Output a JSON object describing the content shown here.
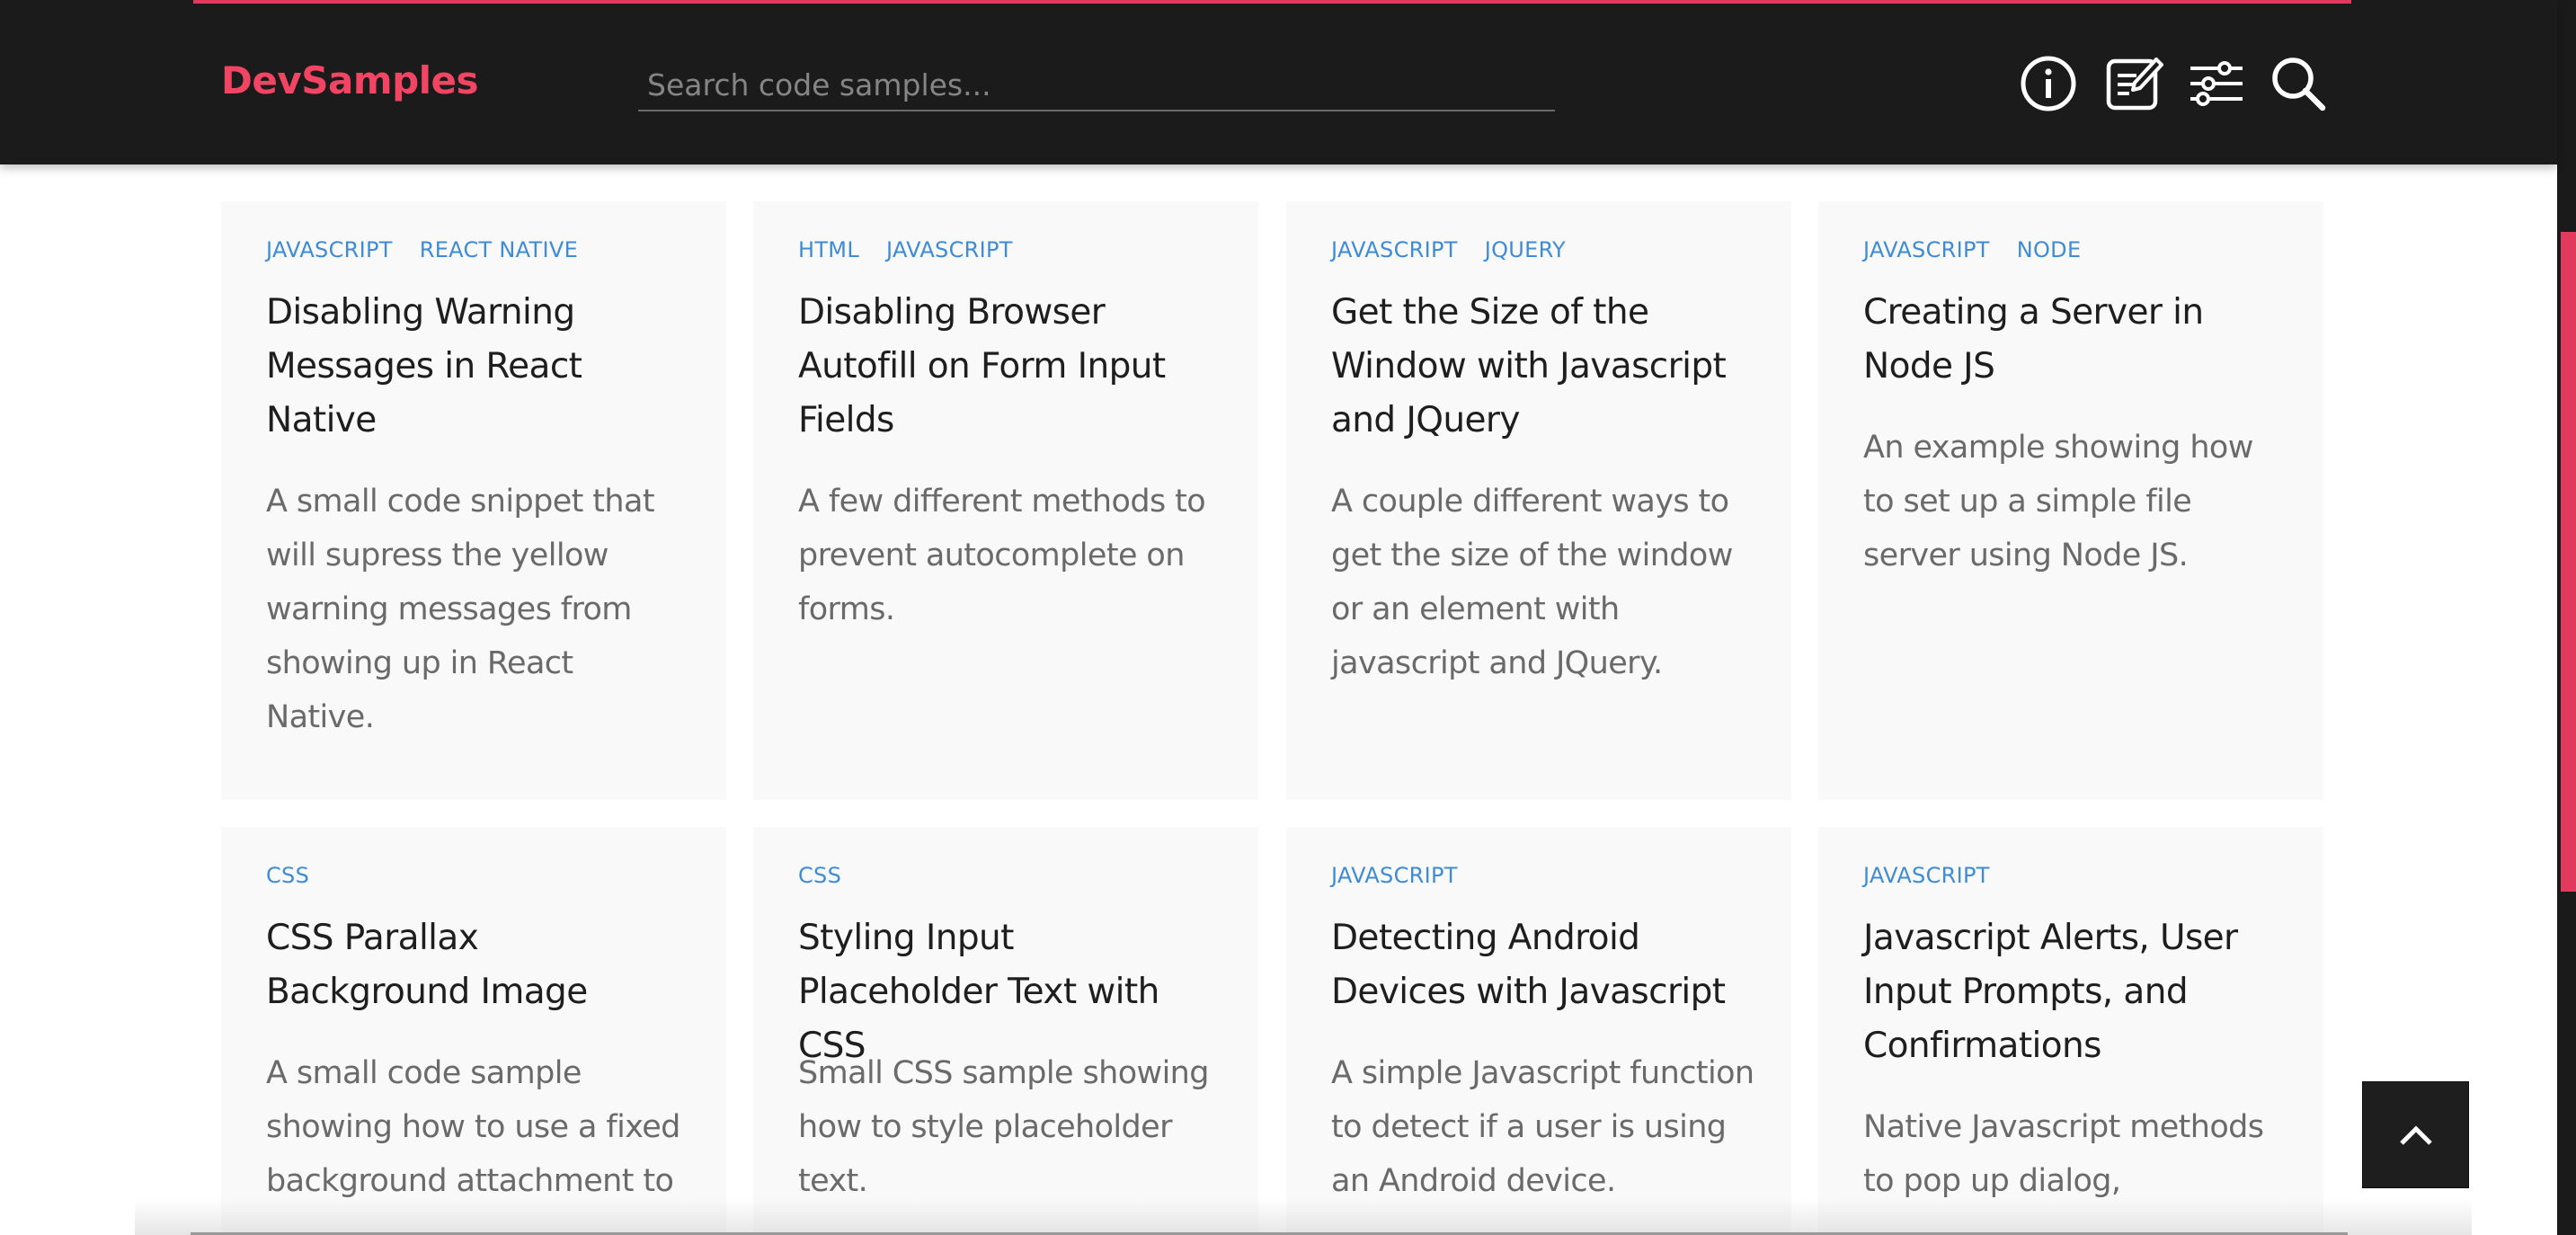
{
  "app": {
    "brand": "DevSamples",
    "accent_color": "#e23a5c"
  },
  "header": {
    "search_placeholder": "Search code samples...",
    "icons": [
      "info-icon",
      "notes-icon",
      "filter-sliders-icon",
      "search-icon"
    ]
  },
  "cards": [
    {
      "tags": [
        "JAVASCRIPT",
        "REACT NATIVE"
      ],
      "title": "Disabling Warning Messages in React Native",
      "description": "A small code snippet that will supress the yellow warning messages from showing up in React Native."
    },
    {
      "tags": [
        "HTML",
        "JAVASCRIPT"
      ],
      "title": "Disabling Browser Autofill on Form Input Fields",
      "description": "A few different methods to prevent autocomplete on forms."
    },
    {
      "tags": [
        "JAVASCRIPT",
        "JQUERY"
      ],
      "title": "Get the Size of the Window with Javascript and JQuery",
      "description": "A couple different ways to get the size of the window or an element with javascript and JQuery."
    },
    {
      "tags": [
        "JAVASCRIPT",
        "NODE"
      ],
      "title": "Creating a Server in Node JS",
      "description": "An example showing how to set up a simple file server using Node JS."
    },
    {
      "tags": [
        "CSS"
      ],
      "title": "CSS Parallax Background Image",
      "description": "A small code sample showing how to use a fixed background attachment to"
    },
    {
      "tags": [
        "CSS"
      ],
      "title": "Styling Input Placeholder Text with CSS",
      "description": "Small CSS sample showing how to style placeholder text."
    },
    {
      "tags": [
        "JAVASCRIPT"
      ],
      "title": "Detecting Android Devices with Javascript",
      "description": "A simple Javascript function to detect if a user is using an Android device."
    },
    {
      "tags": [
        "JAVASCRIPT"
      ],
      "title": "Javascript Alerts, User Input Prompts, and Confirmations",
      "description": "Native Javascript methods to pop up dialog,"
    }
  ],
  "back_to_top_icon": "chevron-up-icon"
}
